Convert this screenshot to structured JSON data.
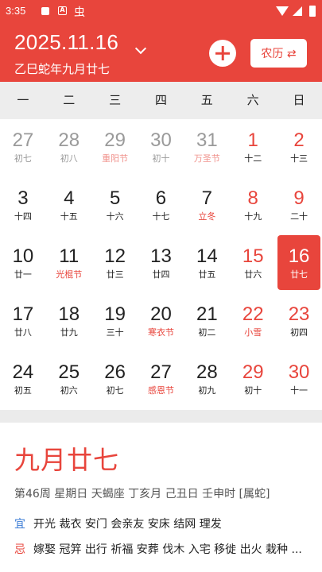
{
  "status_bar": {
    "time": "3:35",
    "app_icon_a": "A",
    "app_icon_bug": "虫"
  },
  "header": {
    "date": "2025.11.16",
    "lunar": "乙巳蛇年九月廿七",
    "lunar_toggle_label": "农历 ⇄",
    "accent": "#e8453c"
  },
  "weekdays": [
    "一",
    "二",
    "三",
    "四",
    "五",
    "六",
    "日"
  ],
  "calendar": {
    "weeks": [
      [
        {
          "num": "27",
          "sub": "初七",
          "other": true
        },
        {
          "num": "28",
          "sub": "初八",
          "other": true
        },
        {
          "num": "29",
          "sub": "重阳节",
          "other": true,
          "fest": true
        },
        {
          "num": "30",
          "sub": "初十",
          "other": true
        },
        {
          "num": "31",
          "sub": "万圣节",
          "other": true,
          "fest": true
        },
        {
          "num": "1",
          "sub": "十二",
          "weekend": true
        },
        {
          "num": "2",
          "sub": "十三",
          "weekend": true
        }
      ],
      [
        {
          "num": "3",
          "sub": "十四"
        },
        {
          "num": "4",
          "sub": "十五"
        },
        {
          "num": "5",
          "sub": "十六"
        },
        {
          "num": "6",
          "sub": "十七"
        },
        {
          "num": "7",
          "sub": "立冬",
          "fest": true
        },
        {
          "num": "8",
          "sub": "十九",
          "weekend": true
        },
        {
          "num": "9",
          "sub": "二十",
          "weekend": true
        }
      ],
      [
        {
          "num": "10",
          "sub": "廿一"
        },
        {
          "num": "11",
          "sub": "光棍节",
          "fest": true
        },
        {
          "num": "12",
          "sub": "廿三"
        },
        {
          "num": "13",
          "sub": "廿四"
        },
        {
          "num": "14",
          "sub": "廿五"
        },
        {
          "num": "15",
          "sub": "廿六",
          "weekend": true
        },
        {
          "num": "16",
          "sub": "廿七",
          "weekend": true,
          "selected": true
        }
      ],
      [
        {
          "num": "17",
          "sub": "廿八"
        },
        {
          "num": "18",
          "sub": "廿九"
        },
        {
          "num": "19",
          "sub": "三十"
        },
        {
          "num": "20",
          "sub": "寒衣节",
          "fest": true
        },
        {
          "num": "21",
          "sub": "初二"
        },
        {
          "num": "22",
          "sub": "小雪",
          "weekend": true,
          "fest": true
        },
        {
          "num": "23",
          "sub": "初四",
          "weekend": true
        }
      ],
      [
        {
          "num": "24",
          "sub": "初五"
        },
        {
          "num": "25",
          "sub": "初六"
        },
        {
          "num": "26",
          "sub": "初七"
        },
        {
          "num": "27",
          "sub": "感恩节",
          "fest": true
        },
        {
          "num": "28",
          "sub": "初九"
        },
        {
          "num": "29",
          "sub": "初十",
          "weekend": true
        },
        {
          "num": "30",
          "sub": "十一",
          "weekend": true
        }
      ]
    ]
  },
  "detail": {
    "lunar_day": "九月廿七",
    "info": "第46周  星期日  天蝎座    丁亥月 己丑日 壬申时 [属蛇]",
    "yi_label": "宜",
    "yi": "开光 裁衣 安门 会亲友 安床 结网 理发",
    "ji_label": "忌",
    "ji": "嫁娶 冠笄 出行 祈福 安葬 伐木 入宅 移徙 出火 栽种 ..."
  }
}
